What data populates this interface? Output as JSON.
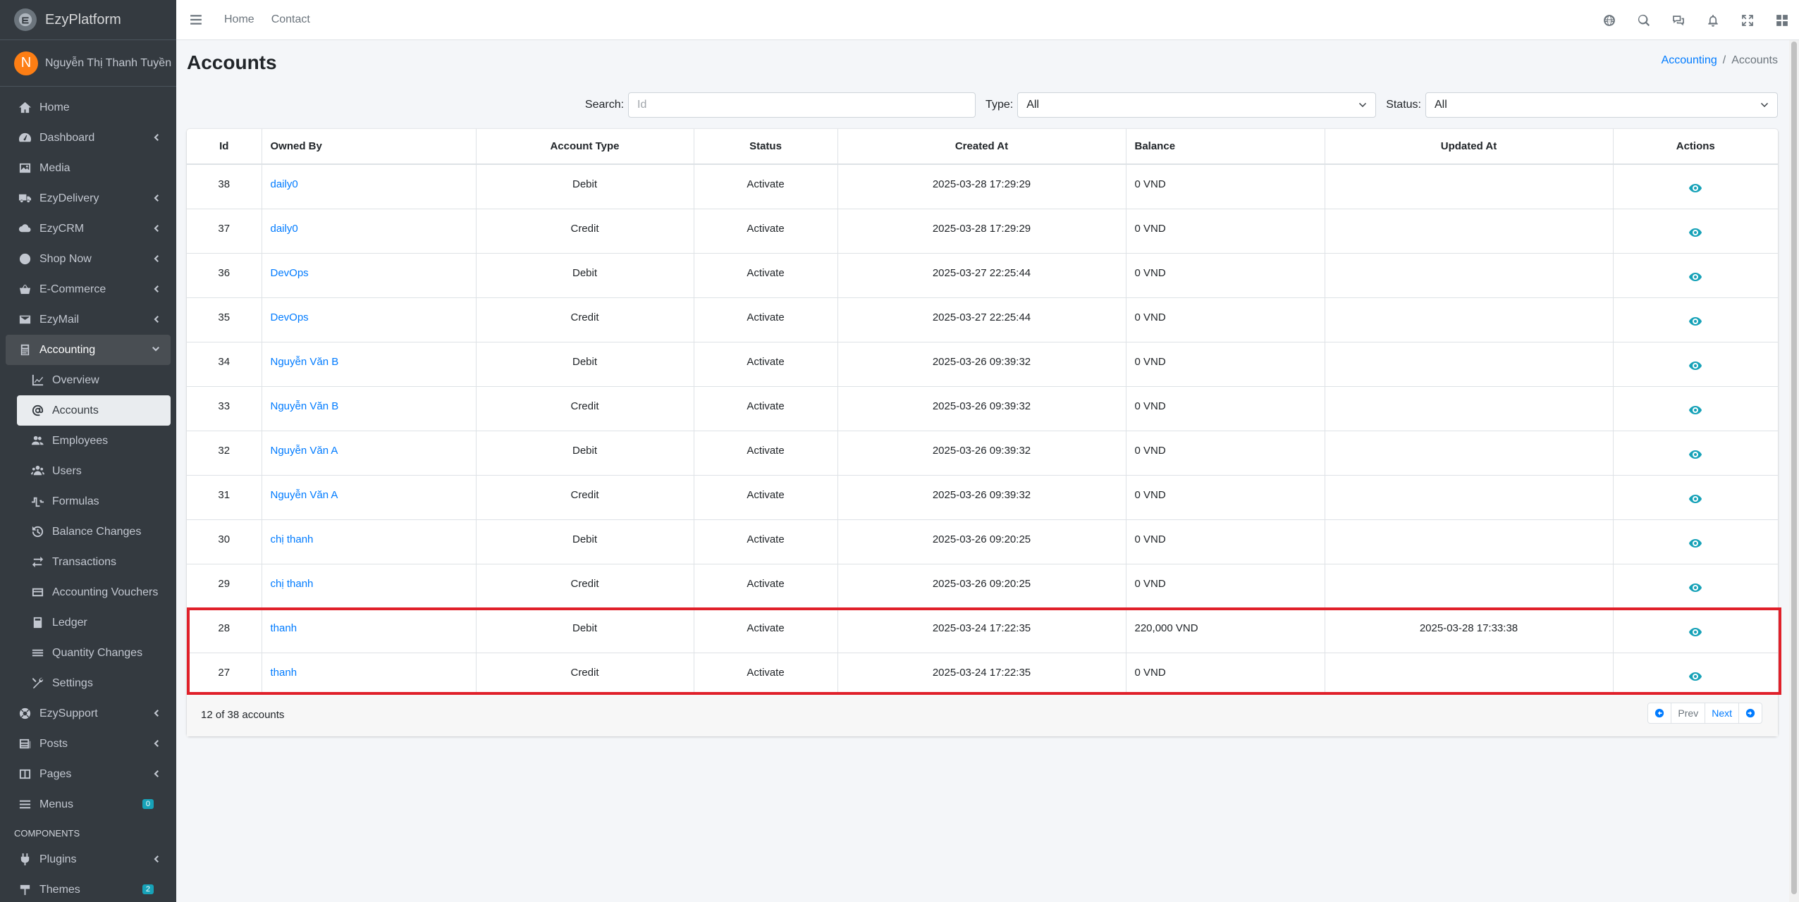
{
  "brand": {
    "name": "EzyPlatform"
  },
  "user": {
    "initial": "N",
    "name": "Nguyễn Thị Thanh Tuyền"
  },
  "sidebar": {
    "items": [
      {
        "label": "Home"
      },
      {
        "label": "Dashboard"
      },
      {
        "label": "Media"
      },
      {
        "label": "EzyDelivery"
      },
      {
        "label": "EzyCRM"
      },
      {
        "label": "Shop Now"
      },
      {
        "label": "E-Commerce"
      },
      {
        "label": "EzyMail"
      },
      {
        "label": "Accounting"
      },
      {
        "label": "Overview"
      },
      {
        "label": "Accounts"
      },
      {
        "label": "Employees"
      },
      {
        "label": "Users"
      },
      {
        "label": "Formulas"
      },
      {
        "label": "Balance Changes"
      },
      {
        "label": "Transactions"
      },
      {
        "label": "Accounting Vouchers"
      },
      {
        "label": "Ledger"
      },
      {
        "label": "Quantity Changes"
      },
      {
        "label": "Settings"
      },
      {
        "label": "EzySupport"
      },
      {
        "label": "Posts"
      },
      {
        "label": "Pages"
      },
      {
        "label": "Menus",
        "badge": "0"
      },
      {
        "label": "Plugins"
      },
      {
        "label": "Themes",
        "badge": "2"
      }
    ],
    "components_header": "COMPONENTS"
  },
  "topbar": {
    "home": "Home",
    "contact": "Contact"
  },
  "page": {
    "title": "Accounts",
    "breadcrumb": {
      "parent": "Accounting",
      "separator": "/",
      "current": "Accounts"
    }
  },
  "filters": {
    "search_label": "Search:",
    "search_placeholder": "Id",
    "type_label": "Type:",
    "type_value": "All",
    "status_label": "Status:",
    "status_value": "All"
  },
  "table": {
    "headers": [
      "Id",
      "Owned By",
      "Account Type",
      "Status",
      "Created At",
      "Balance",
      "Updated At",
      "Actions"
    ],
    "rows": [
      {
        "id": "38",
        "owner": "daily0",
        "type": "Debit",
        "status": "Activate",
        "created": "2025-03-28 17:29:29",
        "balance": "0 VND",
        "updated": ""
      },
      {
        "id": "37",
        "owner": "daily0",
        "type": "Credit",
        "status": "Activate",
        "created": "2025-03-28 17:29:29",
        "balance": "0 VND",
        "updated": ""
      },
      {
        "id": "36",
        "owner": "DevOps",
        "type": "Debit",
        "status": "Activate",
        "created": "2025-03-27 22:25:44",
        "balance": "0 VND",
        "updated": ""
      },
      {
        "id": "35",
        "owner": "DevOps",
        "type": "Credit",
        "status": "Activate",
        "created": "2025-03-27 22:25:44",
        "balance": "0 VND",
        "updated": ""
      },
      {
        "id": "34",
        "owner": "Nguyễn Văn B",
        "type": "Debit",
        "status": "Activate",
        "created": "2025-03-26 09:39:32",
        "balance": "0 VND",
        "updated": ""
      },
      {
        "id": "33",
        "owner": "Nguyễn Văn B",
        "type": "Credit",
        "status": "Activate",
        "created": "2025-03-26 09:39:32",
        "balance": "0 VND",
        "updated": ""
      },
      {
        "id": "32",
        "owner": "Nguyễn Văn A",
        "type": "Debit",
        "status": "Activate",
        "created": "2025-03-26 09:39:32",
        "balance": "0 VND",
        "updated": ""
      },
      {
        "id": "31",
        "owner": "Nguyễn Văn A",
        "type": "Credit",
        "status": "Activate",
        "created": "2025-03-26 09:39:32",
        "balance": "0 VND",
        "updated": ""
      },
      {
        "id": "30",
        "owner": "chị thanh",
        "type": "Debit",
        "status": "Activate",
        "created": "2025-03-26 09:20:25",
        "balance": "0 VND",
        "updated": ""
      },
      {
        "id": "29",
        "owner": "chị thanh",
        "type": "Credit",
        "status": "Activate",
        "created": "2025-03-26 09:20:25",
        "balance": "0 VND",
        "updated": ""
      },
      {
        "id": "28",
        "owner": "thanh",
        "type": "Debit",
        "status": "Activate",
        "created": "2025-03-24 17:22:35",
        "balance": "220,000 VND",
        "updated": "2025-03-28 17:33:38"
      },
      {
        "id": "27",
        "owner": "thanh",
        "type": "Credit",
        "status": "Activate",
        "created": "2025-03-24 17:22:35",
        "balance": "0 VND",
        "updated": ""
      }
    ]
  },
  "footer": {
    "summary": "12 of 38 accounts",
    "prev": "Prev",
    "next": "Next"
  },
  "colors": {
    "sidebar_bg": "#343a40",
    "link": "#007bff",
    "action_icon": "#17a2b8",
    "highlight": "#e0202a"
  }
}
